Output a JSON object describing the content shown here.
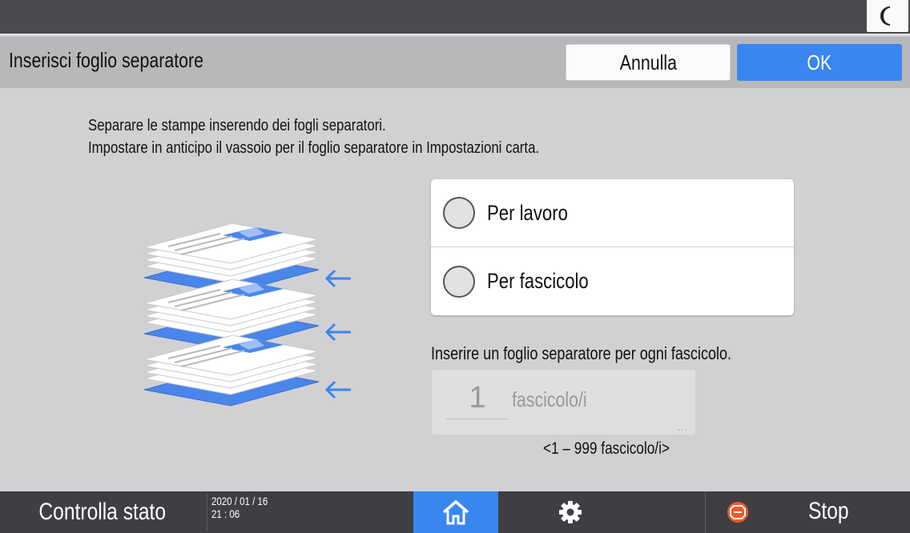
{
  "topbar": {
    "moon_icon": "moon-icon"
  },
  "header": {
    "title": "Inserisci foglio separatore",
    "cancel_label": "Annulla",
    "ok_label": "OK",
    "ok_color": "#3a86f0"
  },
  "description": {
    "line1": "Separare le stampe inserendo dei fogli separatori.",
    "line2": "Impostare in anticipo il vassoio per il foglio separatore in Impostazioni carta."
  },
  "options": [
    {
      "label": "Per lavoro",
      "selected": false
    },
    {
      "label": "Per fascicolo",
      "selected": false
    }
  ],
  "separator": {
    "instruction": "Inserire un foglio separatore per ogni fascicolo.",
    "value": "1",
    "unit": "fascicolo/i",
    "range": "<1 – 999 fascicolo/i>"
  },
  "footer": {
    "status_label": "Controlla stato",
    "date": "2020 / 01 / 16",
    "time": "21 : 06",
    "home_icon": "home-icon",
    "settings_icon": "gear-icon",
    "stop_icon": "stop-icon",
    "stop_label": "Stop",
    "accent": "#3a86f0"
  }
}
